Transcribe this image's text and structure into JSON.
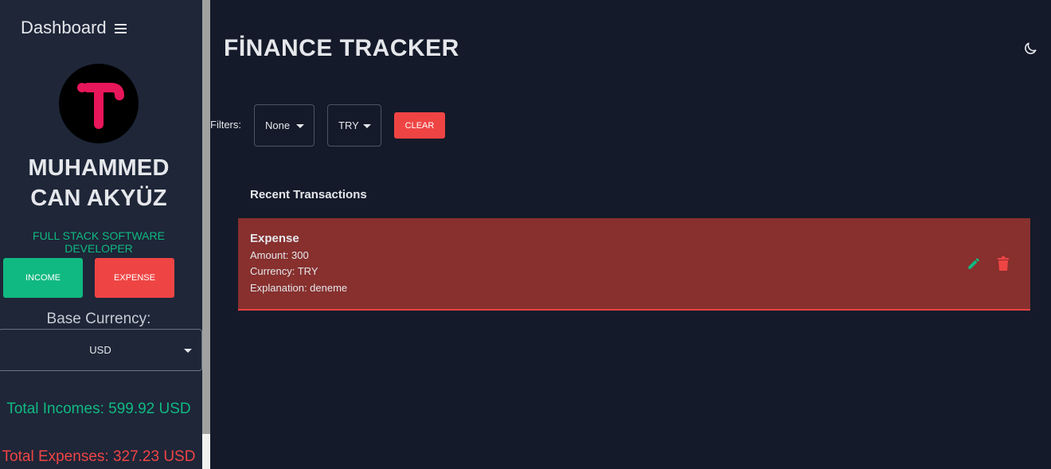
{
  "sidebar": {
    "title": "Dashboard",
    "profile": {
      "name": "MUHAMMED CAN AKYÜZ",
      "role": "FULL STACK SOFTWARE DEVELOPER"
    },
    "buttons": {
      "income": "INCOME",
      "expense": "EXPENSE"
    },
    "base_currency_label": "Base Currency:",
    "base_currency_value": "USD",
    "total_incomes": "Total Incomes: 599.92 USD",
    "total_expenses": "Total Expenses: 327.23 USD"
  },
  "header": {
    "title": "FİNANCE TRACKER"
  },
  "filters": {
    "label": "Filters:",
    "type_value": "None",
    "currency_value": "TRY",
    "clear_label": "CLEAR"
  },
  "transactions": {
    "title": "Recent Transactions",
    "items": [
      {
        "type": "Expense",
        "amount": "Amount: 300",
        "currency": "Currency: TRY",
        "explanation": "Explanation: deneme"
      }
    ]
  },
  "colors": {
    "page_bg": "#141a29",
    "sidebar_bg": "#1e2638",
    "income": "#10b981",
    "expense": "#ef4444",
    "expense_card": "#87302e",
    "logo": "#e8165a"
  },
  "icons": [
    "menu-icon",
    "moon-icon",
    "edit-icon",
    "trash-icon",
    "caret-down-icon"
  ]
}
